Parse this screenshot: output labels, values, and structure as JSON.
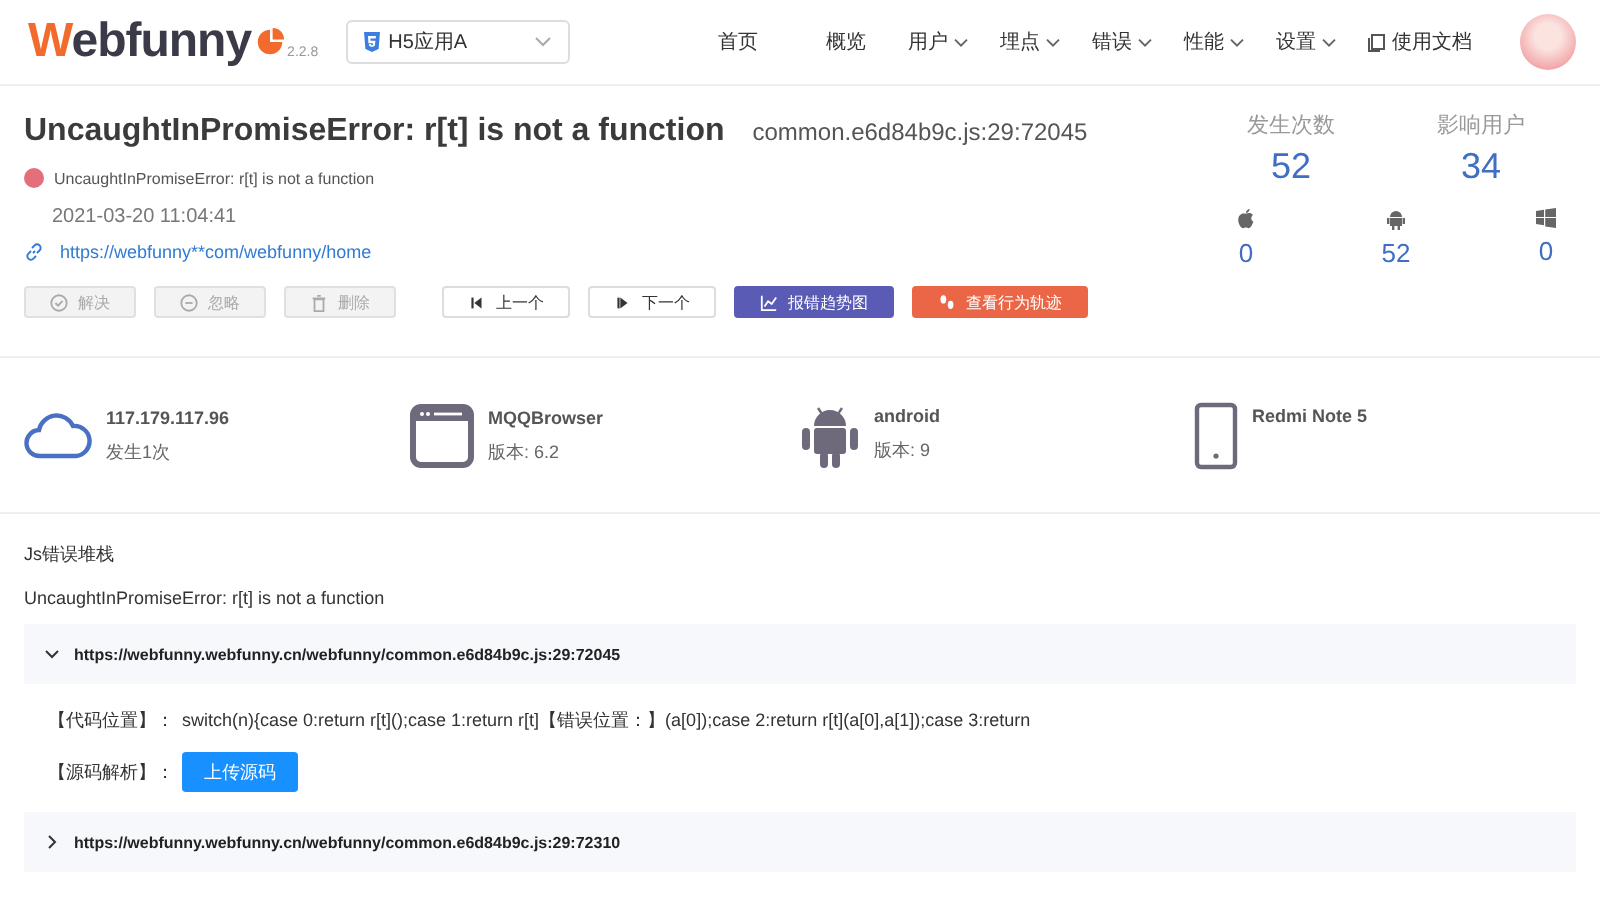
{
  "header": {
    "logo": "Webfunny",
    "version": "2.2.8",
    "app_select": {
      "value": "H5应用A"
    },
    "nav": [
      {
        "label": "首页",
        "dropdown": false
      },
      {
        "label": "概览",
        "dropdown": false
      },
      {
        "label": "用户",
        "dropdown": true
      },
      {
        "label": "埋点",
        "dropdown": true
      },
      {
        "label": "错误",
        "dropdown": true
      },
      {
        "label": "性能",
        "dropdown": true
      },
      {
        "label": "设置",
        "dropdown": true
      }
    ],
    "docs_link": "使用文档"
  },
  "error": {
    "title": "UncaughtInPromiseError: r[t] is not a function",
    "source": "common.e6d84b9c.js:29:72045",
    "message": "UncaughtInPromiseError: r[t] is not a function",
    "time": "2021-03-20 11:04:41",
    "url": "https://webfunny**com/webfunny/home",
    "actions": [
      {
        "label": "解决",
        "kind": "resolve",
        "disabled": true
      },
      {
        "label": "忽略",
        "kind": "ignore",
        "disabled": true
      },
      {
        "label": "删除",
        "kind": "delete",
        "disabled": true
      },
      {
        "label": "上一个",
        "kind": "prev",
        "disabled": false
      },
      {
        "label": "下一个",
        "kind": "next",
        "disabled": false
      },
      {
        "label": "报错趋势图",
        "kind": "trend",
        "disabled": false
      },
      {
        "label": "查看行为轨迹",
        "kind": "track",
        "disabled": false
      }
    ]
  },
  "stats": [
    {
      "label": "发生次数",
      "value": "52"
    },
    {
      "label": "影响用户",
      "value": "34"
    }
  ],
  "platforms": [
    {
      "kind": "apple",
      "value": "0"
    },
    {
      "kind": "android",
      "value": "52"
    },
    {
      "kind": "windows",
      "value": "0"
    }
  ],
  "devices": [
    {
      "kind": "cloud",
      "title": "117.179.117.96",
      "subtitle": "发生1次"
    },
    {
      "kind": "browser",
      "title": "MQQBrowser",
      "subtitle": "版本: 6.2"
    },
    {
      "kind": "android",
      "title": "android",
      "subtitle": "版本: 9"
    },
    {
      "kind": "phone",
      "title": "Redmi Note 5"
    }
  ],
  "stack": {
    "title": "Js错误堆栈",
    "message": "UncaughtInPromiseError: r[t] is not a function",
    "frames": [
      {
        "url": "https://webfunny.webfunny.cn/webfunny/common.e6d84b9c.js:29:72045",
        "expanded": true,
        "code_label": "【代码位置】：",
        "code": "switch(n){case 0:return r[t]();case 1:return r[t]【错误位置：】(a[0]);case 2:return r[t](a[0],a[1]);case 3:return",
        "source_label": "【源码解析】：",
        "upload_button": "上传源码"
      },
      {
        "url": "https://webfunny.webfunny.cn/webfunny/common.e6d84b9c.js:29:72310",
        "expanded": false
      }
    ]
  }
}
